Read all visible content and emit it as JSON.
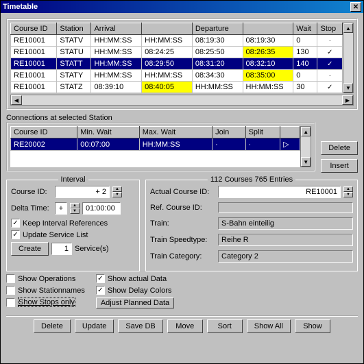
{
  "window": {
    "title": "Timetable"
  },
  "table1": {
    "headers": [
      "Course ID",
      "Station",
      "Arrival",
      "",
      "Departure",
      "",
      "Wait",
      "Stop"
    ],
    "rows": [
      {
        "course_id": "RE10001",
        "station": "STATV",
        "arrival": "HH:MM:SS",
        "arr2": "HH:MM:SS",
        "departure": "08:19:30",
        "dep2": "08:19:30",
        "wait": "0",
        "stop": "·",
        "dep2_hl": false
      },
      {
        "course_id": "RE10001",
        "station": "STATU",
        "arrival": "HH:MM:SS",
        "arr2": "08:24:25",
        "departure": "08:25:50",
        "dep2": "08:26:35",
        "wait": "130",
        "stop": "✓",
        "dep2_hl": true
      },
      {
        "course_id": "RE10001",
        "station": "STATT",
        "arrival": "HH:MM:SS",
        "arr2": "08:29:50",
        "departure": "08:31:20",
        "dep2": "08:32:10",
        "wait": "140",
        "stop": "✓",
        "dep2_hl": false,
        "selected": true
      },
      {
        "course_id": "RE10001",
        "station": "STATY",
        "arrival": "HH:MM:SS",
        "arr2": "HH:MM:SS",
        "departure": "08:34:30",
        "dep2": "08:35:00",
        "wait": "0",
        "stop": "·",
        "dep2_hl": true
      },
      {
        "course_id": "RE10001",
        "station": "STATZ",
        "arrival": "08:39:10",
        "arr2": "08:40:05",
        "departure": "HH:MM:SS",
        "dep2": "HH:MM:SS",
        "wait": "30",
        "stop": "✓",
        "arr2_hl": true
      }
    ]
  },
  "connections": {
    "label": "Connections at selected Station",
    "headers": [
      "Course ID",
      "Min. Wait",
      "Max. Wait",
      "Join",
      "Split",
      ""
    ],
    "rows": [
      {
        "course_id": "RE20002",
        "min_wait": "00:07:00",
        "max_wait": "HH:MM:SS",
        "join": "·",
        "split": "·",
        "last": "▷"
      }
    ]
  },
  "buttons": {
    "delete": "Delete",
    "insert": "Insert"
  },
  "interval": {
    "title": "Interval",
    "course_id_label": "Course ID:",
    "course_id_value": "+ 2",
    "delta_time_label": "Delta Time:",
    "delta_sign": "+",
    "delta_value": "01:00:00",
    "keep_refs": "Keep Interval References",
    "update_list": "Update Service List",
    "create": "Create",
    "services_count": "1",
    "services_label": "Service(s)"
  },
  "details": {
    "title": "112 Courses 765 Entries",
    "actual_label": "Actual Course ID:",
    "actual_value": "RE10001",
    "ref_label": "Ref. Course ID:",
    "ref_value": "",
    "train_label": "Train:",
    "train_value": "S-Bahn einteilig",
    "speed_label": "Train Speedtype:",
    "speed_value": "Reihe R",
    "cat_label": "Train Category:",
    "cat_value": "Category 2"
  },
  "options": {
    "show_operations": "Show Operations",
    "show_stationnames": "Show Stationnames",
    "show_stops_only": "Show Stops only",
    "show_actual": "Show actual Data",
    "show_delay": "Show Delay Colors",
    "adjust": "Adjust Planned Data"
  },
  "bottom": {
    "delete": "Delete",
    "update": "Update",
    "save": "Save DB",
    "move": "Move",
    "sort": "Sort",
    "showall": "Show All",
    "show": "Show"
  }
}
